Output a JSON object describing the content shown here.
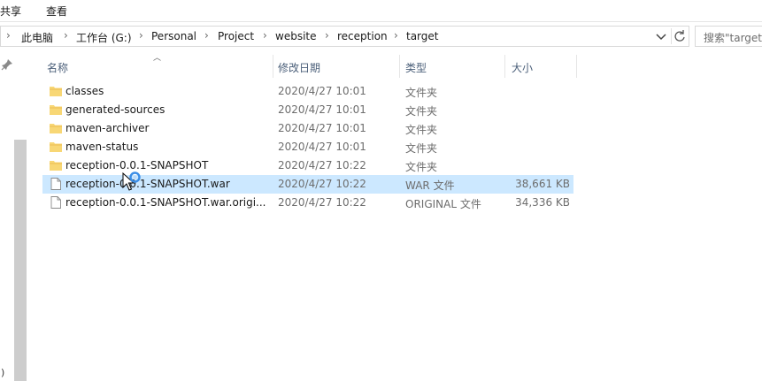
{
  "ribbon": {
    "share_label": "共享",
    "view_label": "查看"
  },
  "address": {
    "crumbs": [
      "此电脑",
      "工作台 (G:)",
      "Personal",
      "Project",
      "website",
      "reception",
      "target"
    ]
  },
  "search": {
    "placeholder": "搜索\"target\""
  },
  "columns": {
    "name": "名称",
    "date": "修改日期",
    "type": "类型",
    "size": "大小"
  },
  "files": [
    {
      "name": "classes",
      "date": "2020/4/27 10:01",
      "type": "文件夹",
      "size": "",
      "icon": "folder-icon"
    },
    {
      "name": "generated-sources",
      "date": "2020/4/27 10:01",
      "type": "文件夹",
      "size": "",
      "icon": "folder-icon"
    },
    {
      "name": "maven-archiver",
      "date": "2020/4/27 10:01",
      "type": "文件夹",
      "size": "",
      "icon": "folder-icon"
    },
    {
      "name": "maven-status",
      "date": "2020/4/27 10:01",
      "type": "文件夹",
      "size": "",
      "icon": "folder-icon"
    },
    {
      "name": "reception-0.0.1-SNAPSHOT",
      "date": "2020/4/27 10:22",
      "type": "文件夹",
      "size": "",
      "icon": "folder-icon"
    },
    {
      "name": "reception-0.0.1-SNAPSHOT.war",
      "date": "2020/4/27 10:22",
      "type": "WAR 文件",
      "size": "38,661 KB",
      "icon": "file-icon"
    },
    {
      "name": "reception-0.0.1-SNAPSHOT.war.origi...",
      "date": "2020/4/27 10:22",
      "type": "ORIGINAL 文件",
      "size": "34,336 KB",
      "icon": "file-icon"
    }
  ],
  "colors": {
    "selection": "#cce8ff",
    "folder": "#f8d775",
    "header_text": "#4c607a"
  }
}
